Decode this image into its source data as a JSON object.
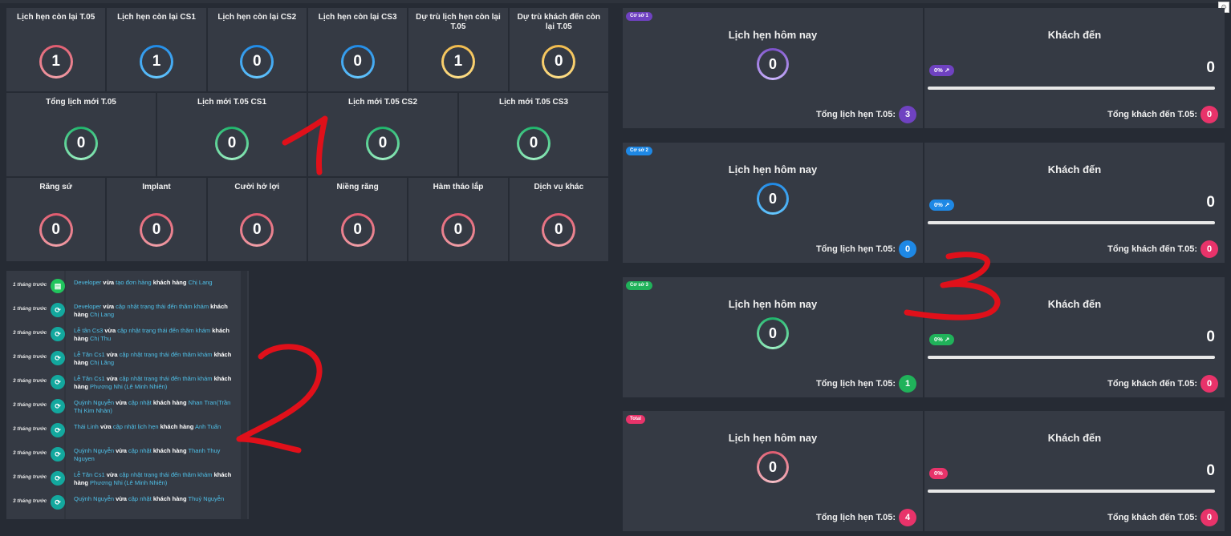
{
  "stats_row1": [
    {
      "label": "Lịch hẹn còn lại T.05",
      "value": "1",
      "color": "red"
    },
    {
      "label": "Lịch hẹn còn lại CS1",
      "value": "1",
      "color": "blue"
    },
    {
      "label": "Lịch hẹn còn lại CS2",
      "value": "0",
      "color": "blue"
    },
    {
      "label": "Lịch hẹn còn lại CS3",
      "value": "0",
      "color": "blue"
    },
    {
      "label": "Dự trù lịch hẹn còn lại T.05",
      "value": "1",
      "color": "yellow"
    },
    {
      "label": "Dự trù khách đến còn lại T.05",
      "value": "0",
      "color": "yellow"
    }
  ],
  "stats_row2": [
    {
      "label": "Tổng lịch mới T.05",
      "value": "0",
      "color": "green"
    },
    {
      "label": "Lịch mới T.05 CS1",
      "value": "0",
      "color": "green"
    },
    {
      "label": "Lịch mới T.05 CS2",
      "value": "0",
      "color": "green"
    },
    {
      "label": "Lịch mới T.05 CS3",
      "value": "0",
      "color": "green"
    }
  ],
  "stats_row3": [
    {
      "label": "Răng sứ",
      "value": "0",
      "color": "red"
    },
    {
      "label": "Implant",
      "value": "0",
      "color": "red"
    },
    {
      "label": "Cười hở lợi",
      "value": "0",
      "color": "red"
    },
    {
      "label": "Niềng răng",
      "value": "0",
      "color": "red"
    },
    {
      "label": "Hàm tháo lắp",
      "value": "0",
      "color": "red"
    },
    {
      "label": "Dịch vụ khác",
      "value": "0",
      "color": "red"
    }
  ],
  "feed": [
    {
      "time": "1 tháng trước",
      "icon": "order-icon",
      "actor": "Developer",
      "verb": "vừa",
      "action": "tạo đơn hàng",
      "pre": "khách hàng",
      "target": "Chị Lang",
      "tail": ""
    },
    {
      "time": "1 tháng trước",
      "icon": "refresh-icon",
      "actor": "Developer",
      "verb": "vừa",
      "action": "cập nhật trạng thái đến thăm khám",
      "pre": "khách hàng",
      "target": "Chị Lang",
      "tail": ""
    },
    {
      "time": "3 tháng trước",
      "icon": "refresh-icon",
      "actor": "Lễ tân Cs3",
      "verb": "vừa",
      "action": "cập nhật trạng thái đến thăm khám",
      "pre": "khách hàng",
      "target": "Chị Thu",
      "tail": ""
    },
    {
      "time": "3 tháng trước",
      "icon": "refresh-icon",
      "actor": "Lễ Tân Cs1",
      "verb": "vừa",
      "action": "cập nhật trạng thái đến thăm khám",
      "pre": "khách hàng",
      "target": "Chị Lăng",
      "tail": ""
    },
    {
      "time": "3 tháng trước",
      "icon": "refresh-icon",
      "actor": "Lễ Tân Cs1",
      "verb": "vừa",
      "action": "cập nhật trạng thái đến thăm khám",
      "pre": "khách hàng",
      "target": "Phương Nhi (Lê Minh Nhiên)",
      "tail": ""
    },
    {
      "time": "3 tháng trước",
      "icon": "refresh-icon",
      "actor": "Quỳnh Nguyễn",
      "verb": "vừa",
      "action": "cập nhật",
      "pre": "khách hàng",
      "target": "Nhan Tran(Trần Thị Kim Nhàn)",
      "tail": ""
    },
    {
      "time": "3 tháng trước",
      "icon": "refresh-icon",
      "actor": "Thái Linh",
      "verb": "vừa",
      "action": "cập nhật lịch hẹn",
      "pre": "khách hàng",
      "target": "Anh Tuấn",
      "tail": ""
    },
    {
      "time": "3 tháng trước",
      "icon": "refresh-icon",
      "actor": "Quỳnh Nguyễn",
      "verb": "vừa",
      "action": "cập nhật",
      "pre": "khách hàng",
      "target": "Thanh Thuy Nguyen",
      "tail": ""
    },
    {
      "time": "3 tháng trước",
      "icon": "refresh-icon",
      "actor": "Lễ Tân Cs1",
      "verb": "vừa",
      "action": "cập nhật trạng thái đến thăm khám",
      "pre": "khách hàng",
      "target": "Phương Nhi (Lê Minh Nhiên)",
      "tail": ""
    },
    {
      "time": "3 tháng trước",
      "icon": "refresh-icon",
      "actor": "Quỳnh Nguyễn",
      "verb": "vừa",
      "action": "cập nhật",
      "pre": "khách hàng",
      "target": "Thuỷ Nguyễn",
      "tail": ""
    }
  ],
  "cards": [
    {
      "badge": "Cơ sở 1",
      "badge_color": "#6f42c1",
      "appt_title": "Lịch hẹn hôm nay",
      "appt_value": "0",
      "ring": "purple",
      "appt_total_label": "Tổng lịch hẹn T.05:",
      "appt_total": "3",
      "pill_color": "#6f42c1",
      "visit_title": "Khách đến",
      "pct": "0%",
      "pct_color": "#6f42c1",
      "trend": true,
      "visit_value": "0",
      "visit_total_label": "Tổng khách đến T.05:",
      "visit_total": "0",
      "progress": 0
    },
    {
      "badge": "Cơ sở 2",
      "badge_color": "#1e88e5",
      "appt_title": "Lịch hẹn hôm nay",
      "appt_value": "0",
      "ring": "blue",
      "appt_total_label": "Tổng lịch hẹn T.05:",
      "appt_total": "0",
      "pill_color": "#1e88e5",
      "visit_title": "Khách đến",
      "pct": "0%",
      "pct_color": "#1e88e5",
      "trend": true,
      "visit_value": "0",
      "visit_total_label": "Tổng khách đến T.05:",
      "visit_total": "0",
      "progress": 0
    },
    {
      "badge": "Cơ sở 3",
      "badge_color": "#20b25a",
      "appt_title": "Lịch hẹn hôm nay",
      "appt_value": "0",
      "ring": "green",
      "appt_total_label": "Tổng lịch hẹn T.05:",
      "appt_total": "1",
      "pill_color": "#20b25a",
      "visit_title": "Khách đến",
      "pct": "0%",
      "pct_color": "#20b25a",
      "trend": true,
      "visit_value": "0",
      "visit_total_label": "Tổng khách đến T.05:",
      "visit_total": "0",
      "progress": 0
    },
    {
      "badge": "Total",
      "badge_color": "#e8336a",
      "appt_title": "Lịch hẹn hôm nay",
      "appt_value": "0",
      "ring": "pink",
      "appt_total_label": "Tổng lịch hẹn T.05:",
      "appt_total": "4",
      "pill_color": "#e8336a",
      "visit_title": "Khách đến",
      "pct": "0%",
      "pct_color": "#e8336a",
      "trend": false,
      "visit_value": "0",
      "visit_total_label": "Tổng khách đến T.05:",
      "visit_total": "0",
      "progress": 0
    }
  ],
  "visit_pill_color": "#e8336a",
  "annotations": [
    "1",
    "2",
    "3"
  ],
  "annotation_color": "#e0101a"
}
